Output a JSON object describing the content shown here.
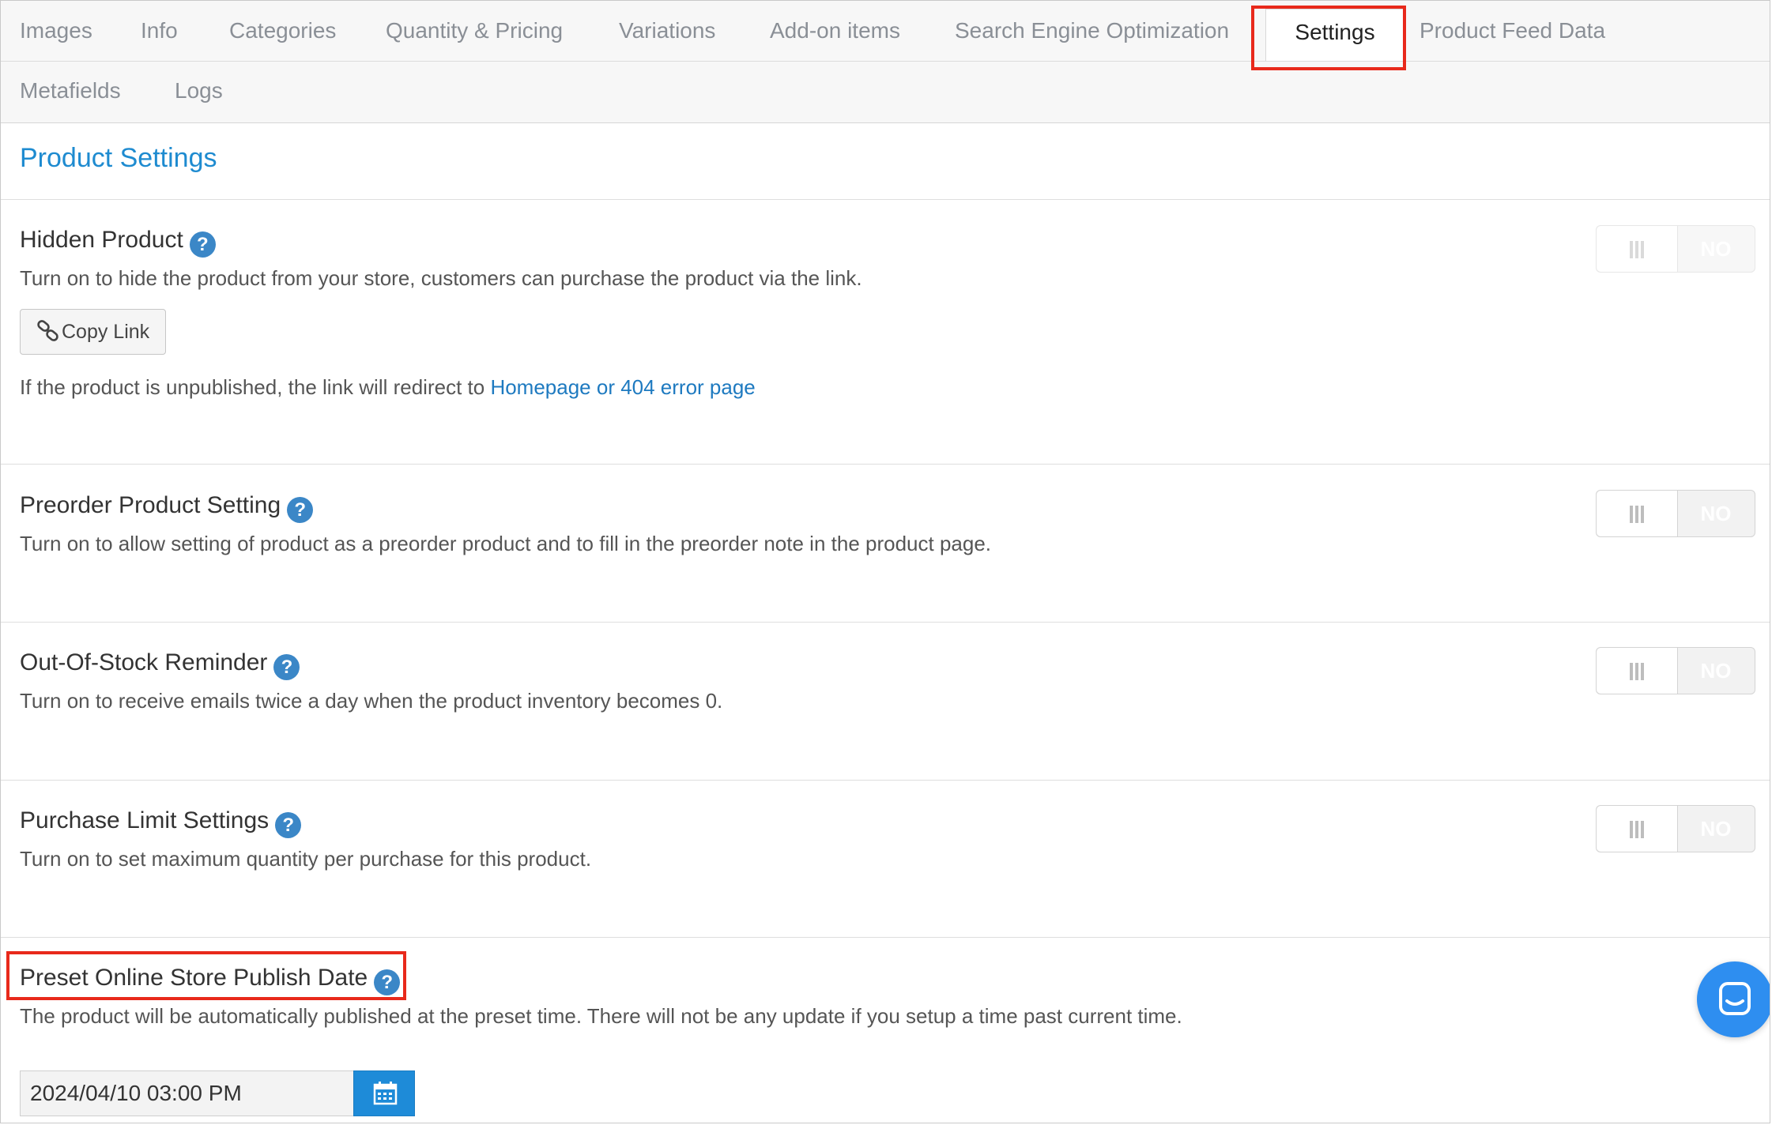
{
  "tabs": {
    "row1": [
      "Images",
      "Info",
      "Categories",
      "Quantity & Pricing",
      "Variations",
      "Add-on items",
      "Search Engine Optimization",
      "Settings",
      "Product Feed Data"
    ],
    "row2": [
      "Metafields",
      "Logs"
    ],
    "active": "Settings"
  },
  "panel": {
    "title": "Product Settings"
  },
  "hidden_product": {
    "title": "Hidden Product",
    "desc": "Turn on to hide the product from your store, customers can purchase the product via the link.",
    "copy_label": "Copy Link",
    "note": "If the product is unpublished, the link will redirect to ",
    "note_link": "Homepage or 404 error page",
    "toggle": "NO"
  },
  "preorder": {
    "title": "Preorder Product Setting",
    "desc": "Turn on to allow setting of product as a preorder product and to fill in the preorder note in the product page.",
    "toggle": "NO"
  },
  "out_of_stock": {
    "title": "Out-Of-Stock Reminder",
    "desc": "Turn on to receive emails twice a day when the product inventory becomes 0.",
    "toggle": "NO"
  },
  "purchase_limit": {
    "title": "Purchase Limit Settings",
    "desc": "Turn on to set maximum quantity per purchase for this product.",
    "toggle": "NO"
  },
  "publish_date": {
    "title": "Preset Online Store Publish Date",
    "desc": "The product will be automatically published at the preset time. There will not be any update if you setup a time past current time.",
    "value": "2024/04/10 03:00 PM"
  },
  "help_glyph": "?",
  "colors": {
    "accent": "#1e8bd0",
    "highlight": "#e8291b",
    "chat": "#2e8ef0"
  },
  "icons": [
    "help-icon",
    "link-icon",
    "calendar-icon",
    "chat-icon"
  ]
}
